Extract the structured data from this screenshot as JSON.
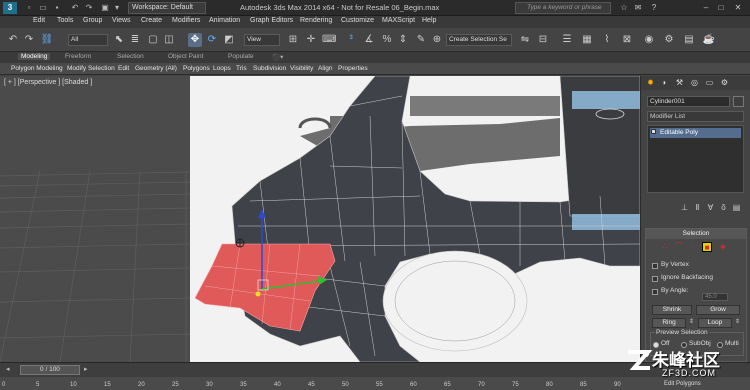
{
  "app": {
    "logo_text": "3",
    "workspace": "Workspace: Default",
    "window_title": "Autodesk 3ds Max  2014 x64  -  Not for Resale    06_Begin.max",
    "search_placeholder": "Type a keyword or phrase"
  },
  "menu": [
    "Edit",
    "Tools",
    "Group",
    "Views",
    "Create",
    "Modifiers",
    "Animation",
    "Graph Editors",
    "Rendering",
    "Customize",
    "MAXScript",
    "Help"
  ],
  "toolbar": {
    "filter_value": "All",
    "refcoord_value": "View",
    "selection_set": "Create Selection Se"
  },
  "ribbon": {
    "tabs": [
      "Modeling",
      "Freeform",
      "Selection",
      "Object Paint",
      "Populate"
    ],
    "items": [
      "Polygon Modeling",
      "Modify Selection",
      "Edit",
      "Geometry (All)",
      "Polygons",
      "Loops",
      "Tris",
      "Subdivision",
      "Visibility",
      "Align",
      "Properties"
    ]
  },
  "viewport": {
    "label": "[ + ] [Perspective ] [Shaded ]"
  },
  "command_panel": {
    "object_name": "Cylinder001",
    "modifier_list": "Modifier List",
    "stack_item": "Editable Poly",
    "selection": {
      "header": "Selection",
      "by_vertex": "By Vertex",
      "ignore_backfacing": "Ignore Backfacing",
      "by_angle": "By Angle:",
      "angle_value": "45.0",
      "shrink": "Shrink",
      "grow": "Grow",
      "ring": "Ring",
      "loop": "Loop",
      "preview_selection": "Preview Selection",
      "off": "Off",
      "subobj": "SubObj",
      "multi": "Multi"
    }
  },
  "timeline": {
    "slider": "0 / 100",
    "ticks": [
      "0",
      "5",
      "10",
      "15",
      "20",
      "25",
      "30",
      "35",
      "40",
      "45",
      "50",
      "55",
      "60",
      "65",
      "70",
      "75",
      "80",
      "85",
      "90"
    ]
  },
  "status": {
    "bottom_right": "Edit Polygons"
  },
  "watermark": {
    "cn": "朱峰社区",
    "en": "ZF3D.COM"
  },
  "colors": {
    "selection_red": "#e05a5a",
    "active_blue": "#5fb0ff",
    "panel_tab_active": "#ffb000"
  }
}
